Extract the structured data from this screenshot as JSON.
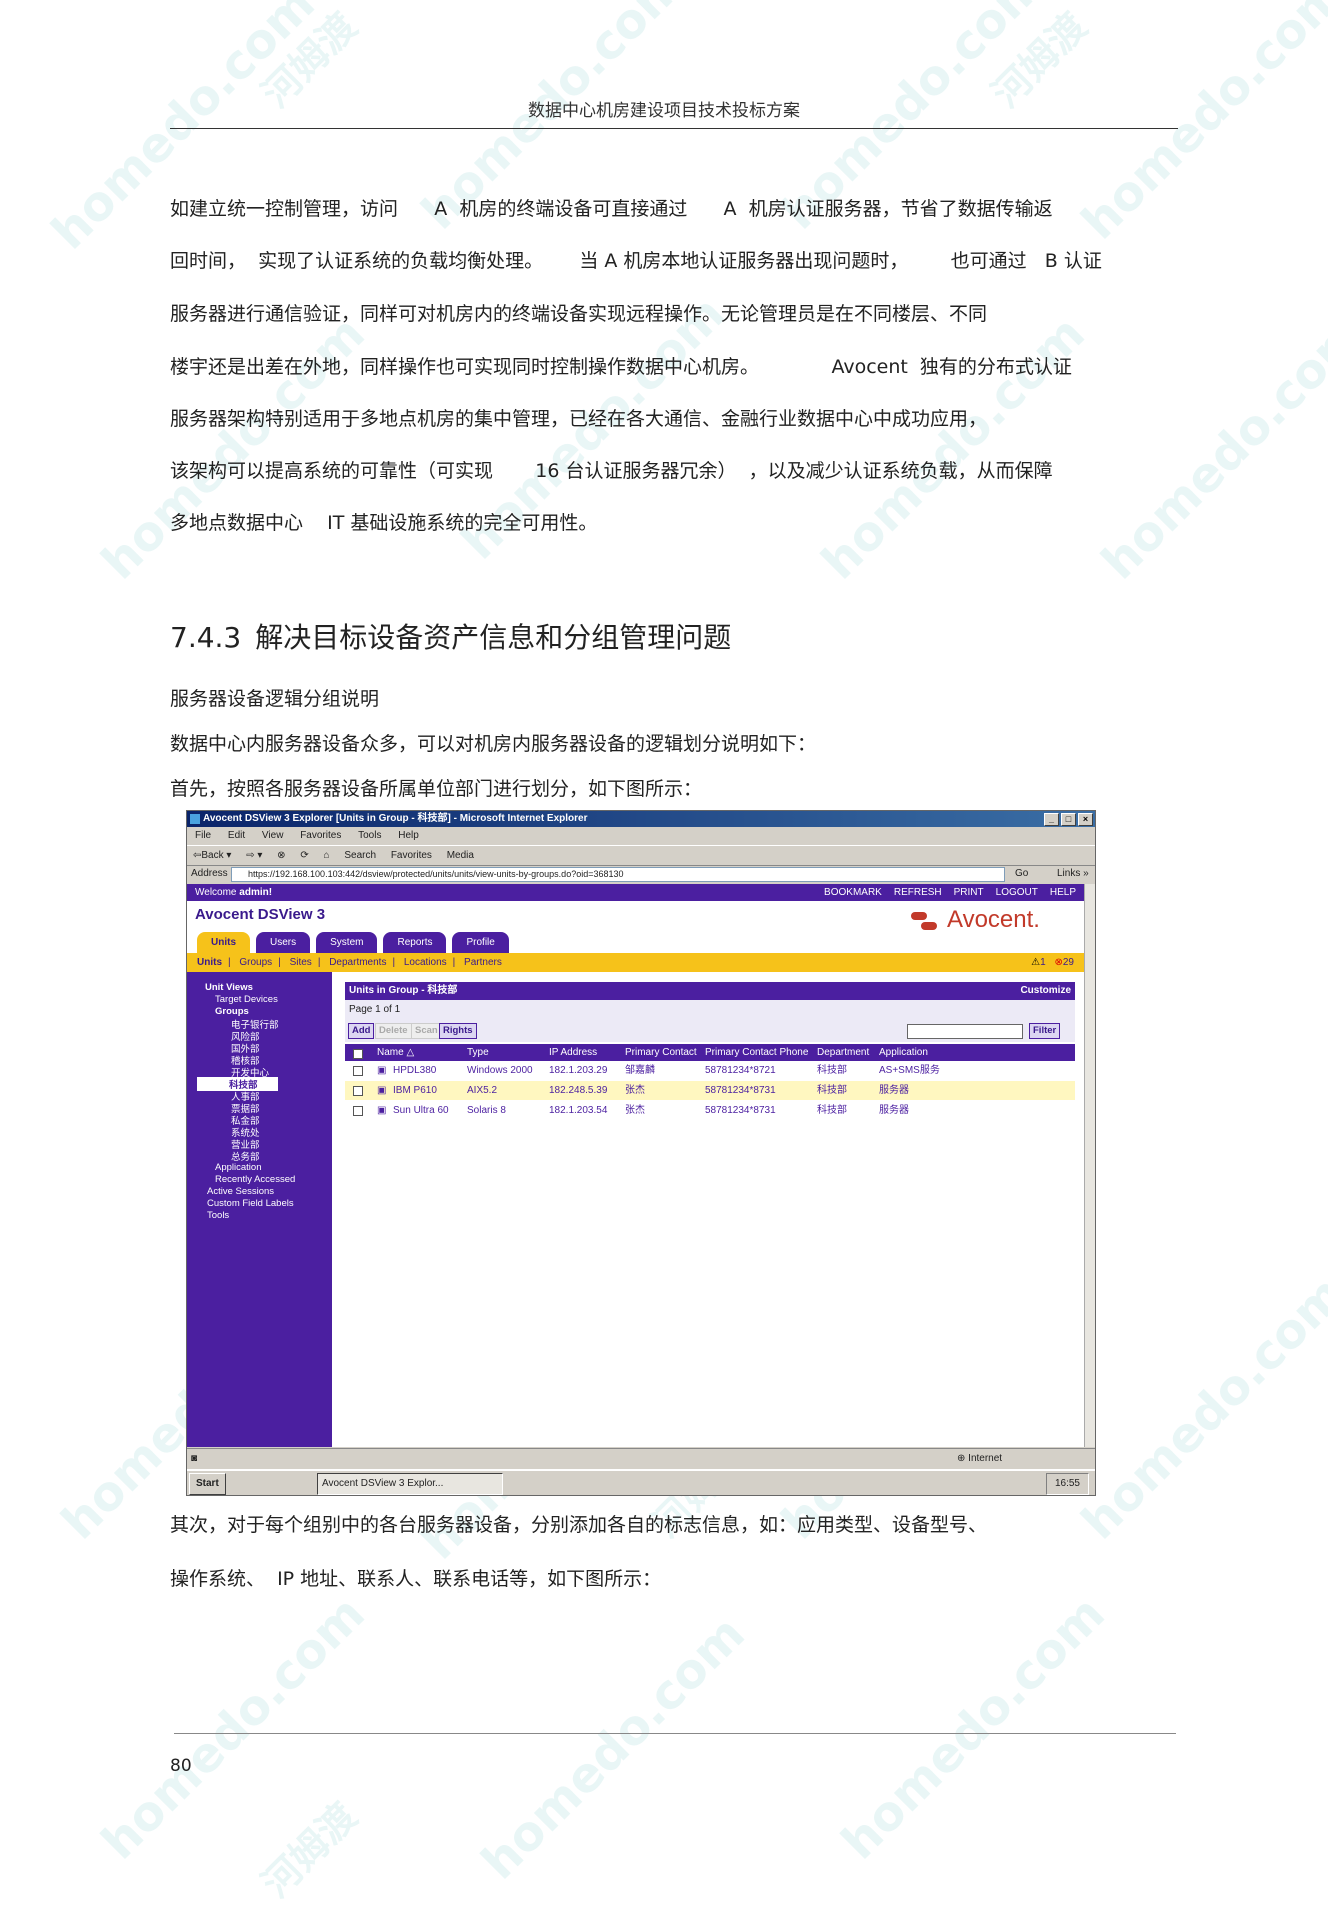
{
  "header": {
    "title": "数据中心机房建设项目技术投标方案"
  },
  "paragraph1": {
    "lines": [
      "如建立统一控制管理，访问      A  机房的终端设备可直接通过      A  机房认证服务器，节省了数据传输返",
      "回时间，  实现了认证系统的负载均衡处理。      当 A 机房本地认证服务器出现问题时，       也可通过   B 认证",
      "服务器进行通信验证，同样可对机房内的终端设备实现远程操作。无论管理员是在不同楼层、不同",
      "楼宇还是出差在外地，同样操作也可实现同时控制操作数据中心机房。            Avocent  独有的分布式认证",
      "服务器架构特别适用于多地点机房的集中管理，已经在各大通信、金融行业数据中心中成功应用，",
      "该架构可以提高系统的可靠性（可实现       16 台认证服务器冗余）  ，以及减少认证系统负载，从而保障",
      "多地点数据中心    IT 基础设施系统的完全可用性。"
    ]
  },
  "section": {
    "number": "7.4.3",
    "title": "解决目标设备资产信息和分组管理问题"
  },
  "paragraph2": {
    "lines": [
      "服务器设备逻辑分组说明",
      "数据中心内服务器设备众多，可以对机房内服务器设备的逻辑划分说明如下：",
      "首先，按照各服务器设备所属单位部门进行划分，如下图所示："
    ]
  },
  "screenshot": {
    "window_title": "Avocent DSView 3 Explorer [Units in Group - 科技部] - Microsoft Internet Explorer",
    "menu": [
      "File",
      "Edit",
      "View",
      "Favorites",
      "Tools",
      "Help"
    ],
    "toolbar": [
      "⇦Back ▾",
      "⇨ ▾",
      "⊗",
      "⟳",
      "⌂",
      "Search",
      "Favorites",
      "Media"
    ],
    "address_label": "Address",
    "address_url": "https://192.168.100.103:442/dsview/protected/units/units/view-units-by-groups.do?oid=368130",
    "go_label": "Go",
    "links_label": "Links »",
    "welcome_prefix": "Welcome ",
    "welcome_user": "admin!",
    "top_nav": [
      "BOOKMARK",
      "REFRESH",
      "PRINT",
      "LOGOUT",
      "HELP"
    ],
    "brand": "Avocent DSView 3",
    "logo": "Avocent.",
    "tabs": [
      "Units",
      "Users",
      "System",
      "Reports",
      "Profile"
    ],
    "subnav": [
      "Units",
      "Groups",
      "Sites",
      "Departments",
      "Locations",
      "Partners"
    ],
    "subnav_separator": "|",
    "alerts": {
      "warning": "1",
      "error": "29"
    },
    "sidebar": {
      "unit_views": "Unit Views",
      "target_devices": "Target Devices",
      "groups": "Groups",
      "group_items": [
        "电子银行部",
        "风险部",
        "国外部",
        "稽核部",
        "开发中心",
        "科技部",
        "人事部",
        "票据部",
        "私金部",
        "系统处",
        "营业部",
        "总务部"
      ],
      "application": "Application",
      "recently_accessed": "Recently Accessed",
      "active_sessions": "Active Sessions",
      "custom_field_labels": "Custom Field Labels",
      "tools": "Tools"
    },
    "table_title": "Units in Group - 科技部",
    "customize": "Customize",
    "page_info": "Page 1 of 1",
    "buttons": {
      "add": "Add",
      "delete": "Delete",
      "scan": "Scan",
      "rights": "Rights",
      "filter": "Filter"
    },
    "columns": [
      "Name △",
      "Type",
      "IP Address",
      "Primary Contact",
      "Primary Contact Phone",
      "Department",
      "Application"
    ],
    "rows": [
      [
        "HPDL380",
        "Windows 2000",
        "182.1.203.29",
        "邹嘉麟",
        "58781234*8721",
        "科技部",
        "AS+SMS服务"
      ],
      [
        "IBM P610",
        "AIX5.2",
        "182.248.5.39",
        "张杰",
        "58781234*8731",
        "科技部",
        "服务器"
      ],
      [
        "Sun Ultra 60",
        "Solaris 8",
        "182.1.203.54",
        "张杰",
        "58781234*8731",
        "科技部",
        "服务器"
      ]
    ],
    "status_zone": "Internet",
    "start_label": "Start",
    "task_label": "Avocent DSView 3 Explor...",
    "clock": "16:55"
  },
  "paragraph3": {
    "lines": [
      "其次，对于每个组别中的各台服务器设备，分别添加各自的标志信息，如：应用类型、设备型号、",
      "操作系统、  IP 地址、联系人、联系电话等，如下图所示："
    ]
  },
  "footer": {
    "page_number": "80"
  },
  "watermark": {
    "text_cn": "河姆渡",
    "text_en": "homedo.com"
  },
  "colors": {
    "accent_purple": "#4b1fa0",
    "accent_yellow": "#f6c21a",
    "logo_red": "#c23a2a"
  }
}
